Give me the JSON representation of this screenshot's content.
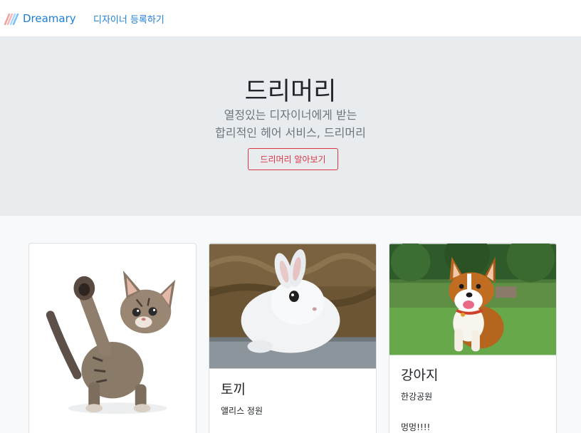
{
  "navbar": {
    "brand_text": "Dreamary",
    "logo_icon": "dreamary-logo-icon",
    "register_link": "디자이너 등록하기"
  },
  "hero": {
    "title": "드리머리",
    "subtitle_line1": "열정있는 디자이너에게 받는",
    "subtitle_line2": "합리적인 헤어 서비스, 드리머리",
    "button_label": "드리머리 알아보기"
  },
  "cards": [
    {
      "image": "kitten-photo",
      "title": "",
      "subtitle": "",
      "text": ""
    },
    {
      "image": "white-bunny-photo",
      "title": "토끼",
      "subtitle": "앨리스 정원",
      "text": ""
    },
    {
      "image": "corgi-dog-photo",
      "title": "강아지",
      "subtitle": "한강공원",
      "text": "멍멍!!!!"
    }
  ],
  "colors": {
    "link": "#1c7ed6",
    "hero_bg": "#e9ecef",
    "danger": "#dc3545",
    "page_bg": "#f8f9fa"
  }
}
